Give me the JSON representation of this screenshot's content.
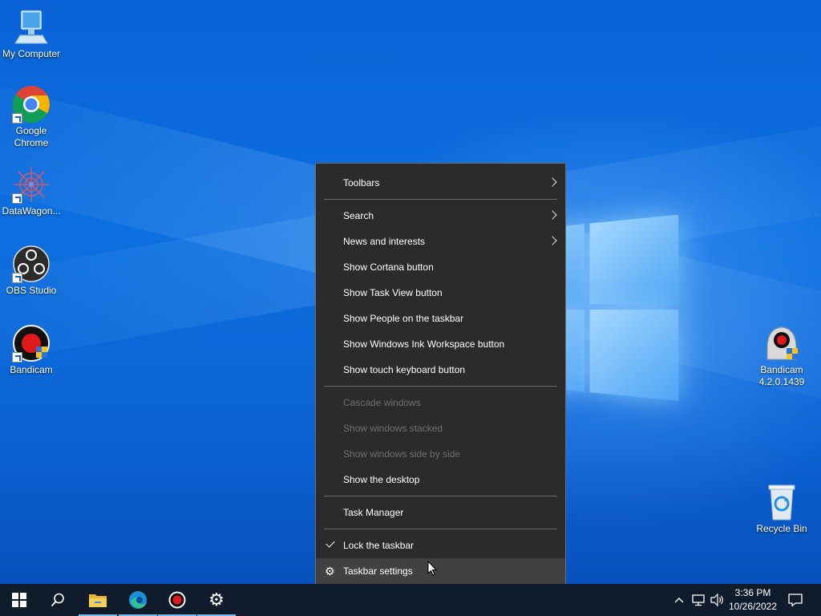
{
  "desktop": {
    "icons_left": [
      {
        "label": "My Computer",
        "icon": "computer-icon"
      },
      {
        "label": "Google Chrome",
        "icon": "chrome-icon"
      },
      {
        "label": "DataWagon...",
        "icon": "datawagon-icon"
      },
      {
        "label": "OBS Studio",
        "icon": "obs-icon"
      },
      {
        "label": "Bandicam",
        "icon": "bandicam-icon"
      }
    ],
    "icons_right": [
      {
        "label": "Bandicam 4.2.0.1439",
        "icon": "bandicam-installer-icon"
      },
      {
        "label": "Recycle Bin",
        "icon": "recycle-bin-icon"
      }
    ]
  },
  "context_menu": {
    "groups": [
      [
        {
          "label": "Toolbars",
          "submenu": true
        }
      ],
      [
        {
          "label": "Search",
          "submenu": true
        },
        {
          "label": "News and interests",
          "submenu": true
        },
        {
          "label": "Show Cortana button"
        },
        {
          "label": "Show Task View button"
        },
        {
          "label": "Show People on the taskbar"
        },
        {
          "label": "Show Windows Ink Workspace button"
        },
        {
          "label": "Show touch keyboard button"
        }
      ],
      [
        {
          "label": "Cascade windows",
          "disabled": true
        },
        {
          "label": "Show windows stacked",
          "disabled": true
        },
        {
          "label": "Show windows side by side",
          "disabled": true
        },
        {
          "label": "Show the desktop"
        }
      ],
      [
        {
          "label": "Task Manager"
        }
      ],
      [
        {
          "label": "Lock the taskbar",
          "checked": true
        },
        {
          "label": "Taskbar settings",
          "icon": "gear-icon",
          "hovered": true
        }
      ]
    ]
  },
  "taskbar": {
    "buttons": [
      {
        "name": "start",
        "icon": "windows-logo-icon"
      },
      {
        "name": "search",
        "icon": "search-icon"
      },
      {
        "name": "file-explorer",
        "icon": "folder-icon",
        "active": true
      },
      {
        "name": "edge",
        "icon": "edge-icon",
        "active": true
      },
      {
        "name": "bandicam",
        "icon": "record-icon",
        "active": true
      },
      {
        "name": "settings",
        "icon": "gear-icon",
        "active": true
      }
    ],
    "tray": {
      "time": "3:36 PM",
      "date": "10/26/2022",
      "icons": [
        "chevron-up-icon",
        "network-icon",
        "volume-icon",
        "notification-icon"
      ]
    }
  },
  "colors": {
    "menu_bg": "#2b2b2b",
    "taskbar_bg": "#101b2c",
    "desktop_blue": "#0b62d3"
  }
}
